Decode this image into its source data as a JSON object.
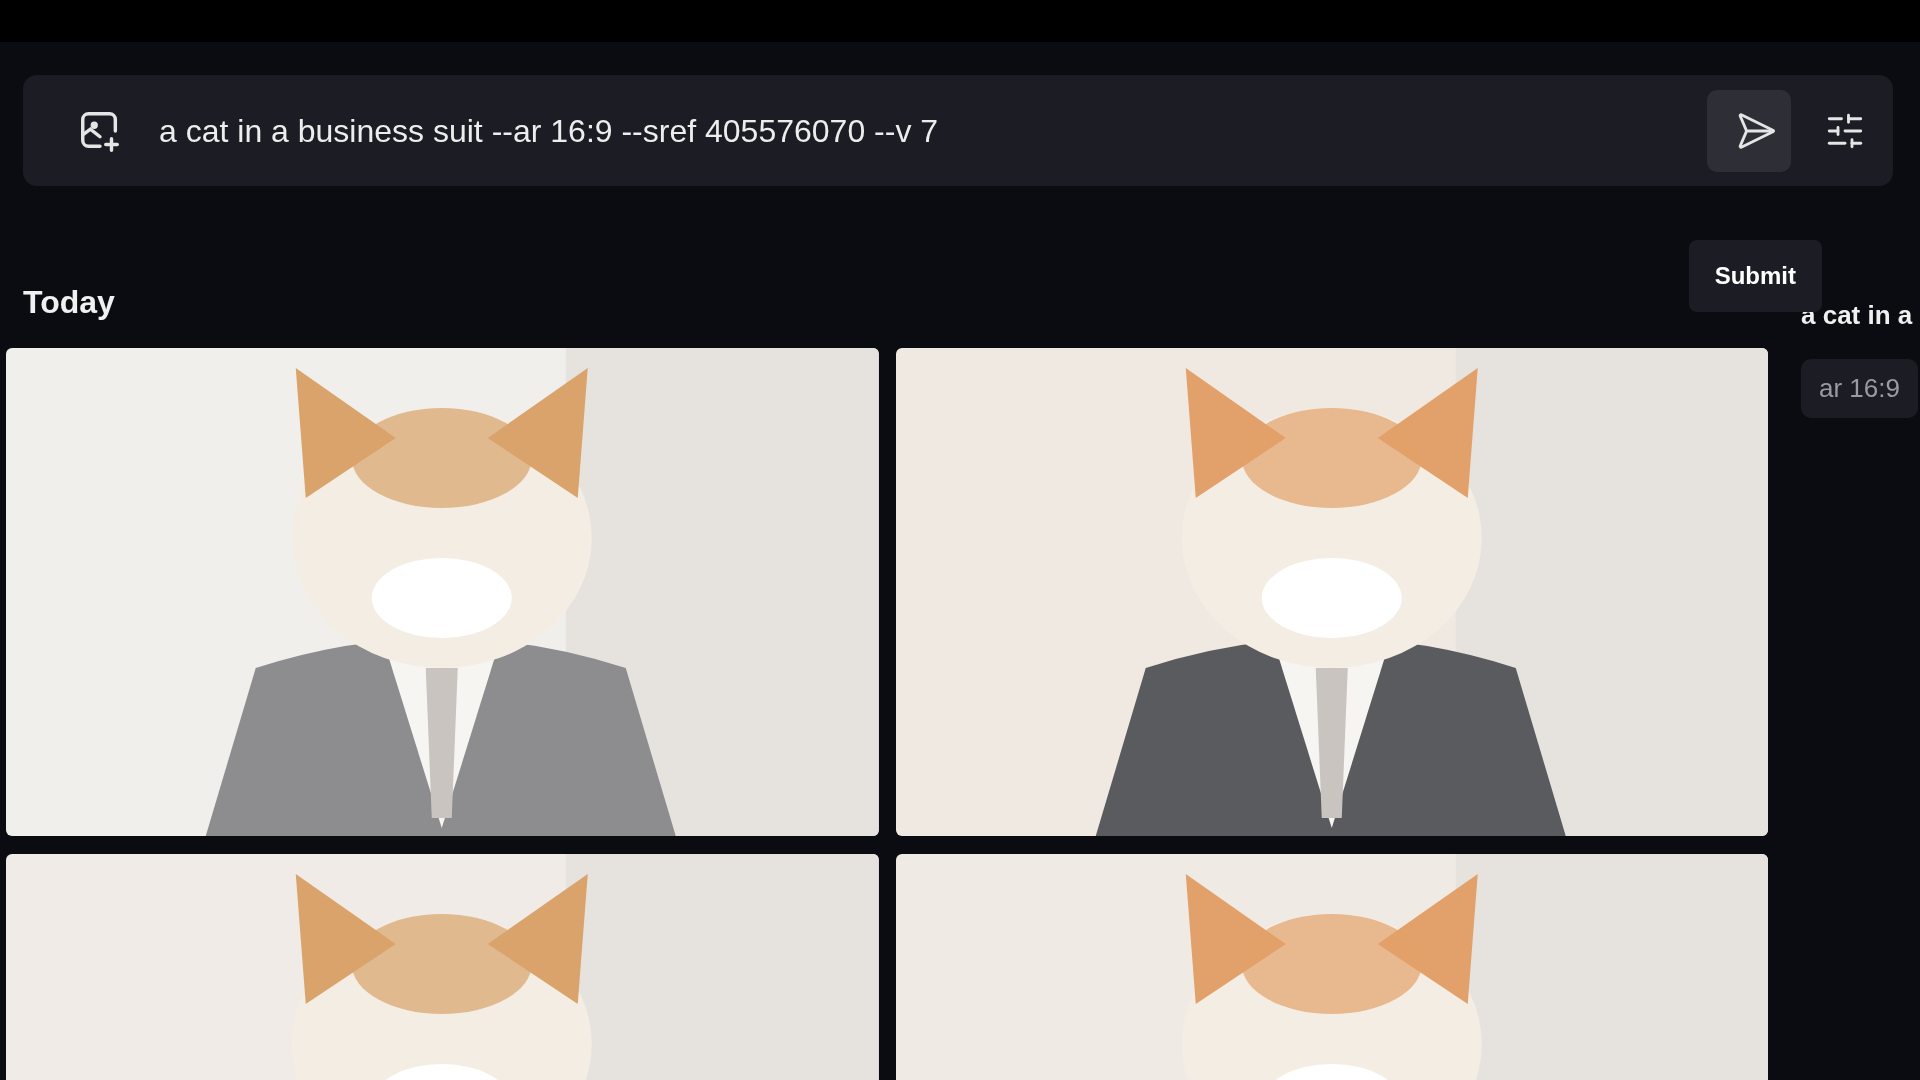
{
  "prompt_bar": {
    "value": "a cat in a business suit --ar 16:9 --sref 405576070 --v 7",
    "tooltip": "Submit"
  },
  "section": {
    "title": "Today"
  },
  "side_panel": {
    "prompt": "a cat in a",
    "chips": [
      "ar 16:9"
    ]
  }
}
